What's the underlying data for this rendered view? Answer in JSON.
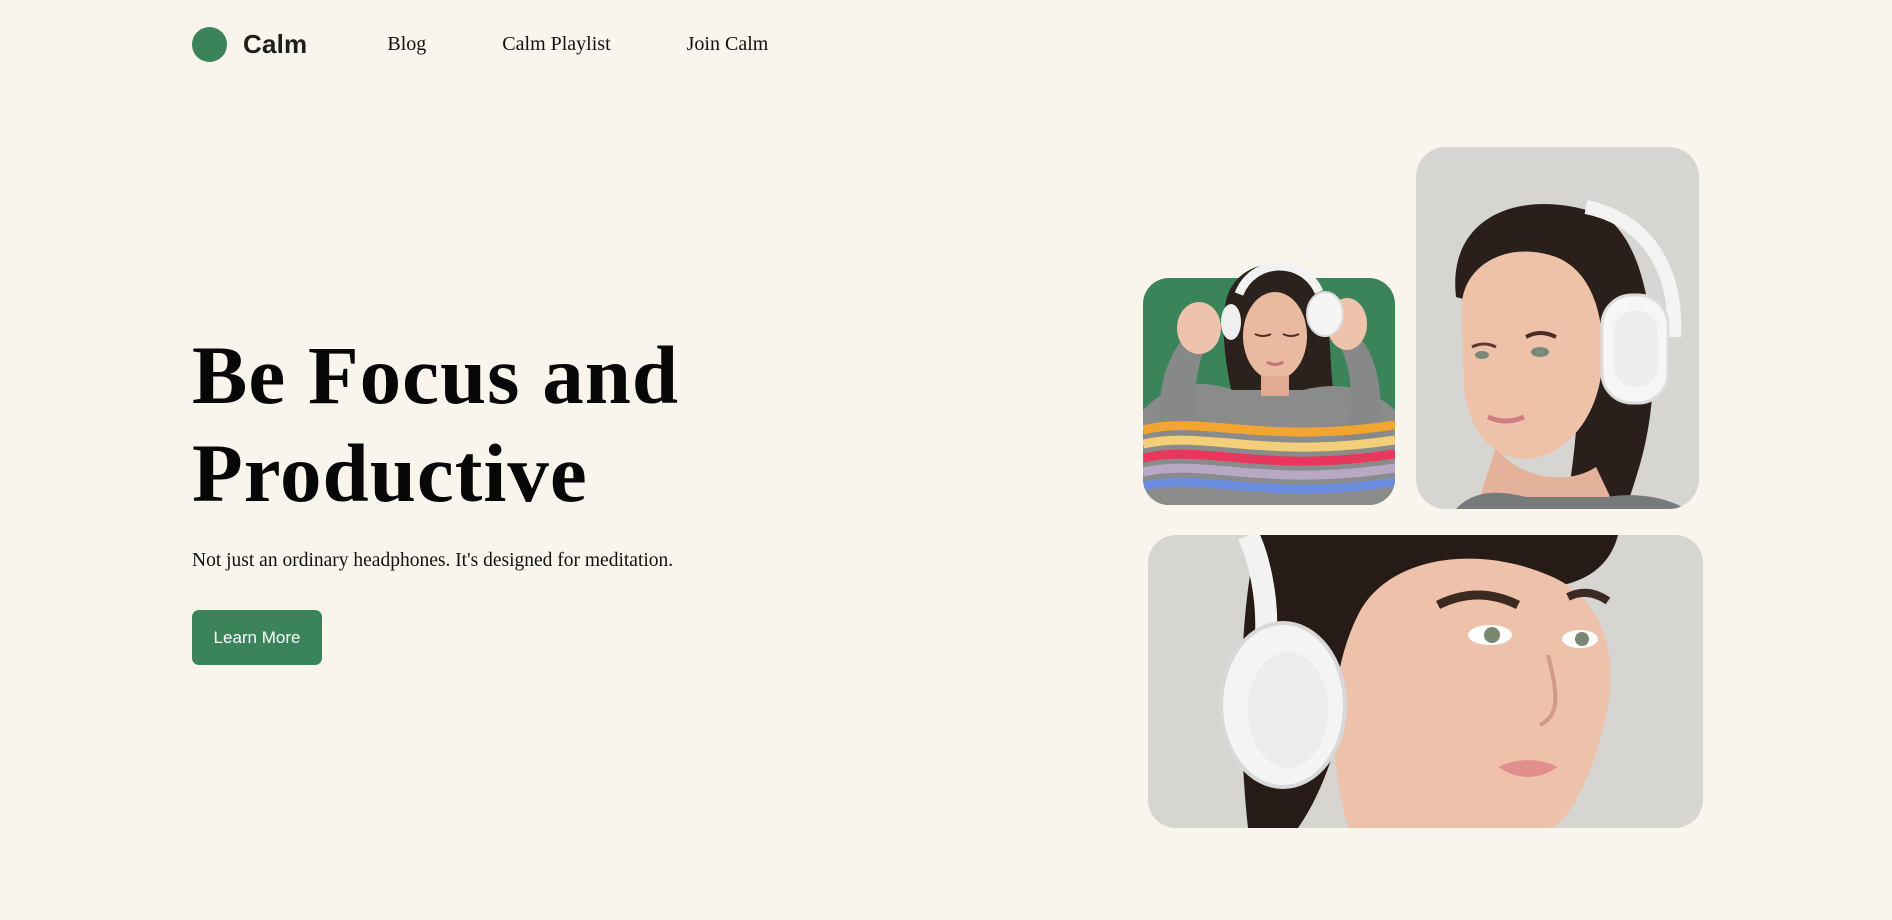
{
  "brand": {
    "name": "Calm",
    "color": "#3b845a"
  },
  "nav": {
    "items": [
      "Blog",
      "Calm Playlist",
      "Join Calm"
    ]
  },
  "hero": {
    "title": "Be Focus and Productive",
    "subtitle": "Not just an ordinary headphones. It's designed for meditation.",
    "cta_label": "Learn More"
  },
  "colors": {
    "background": "#f9f4ec",
    "accent": "#3b845a",
    "photo_backdrop": "#d6d5d1"
  }
}
